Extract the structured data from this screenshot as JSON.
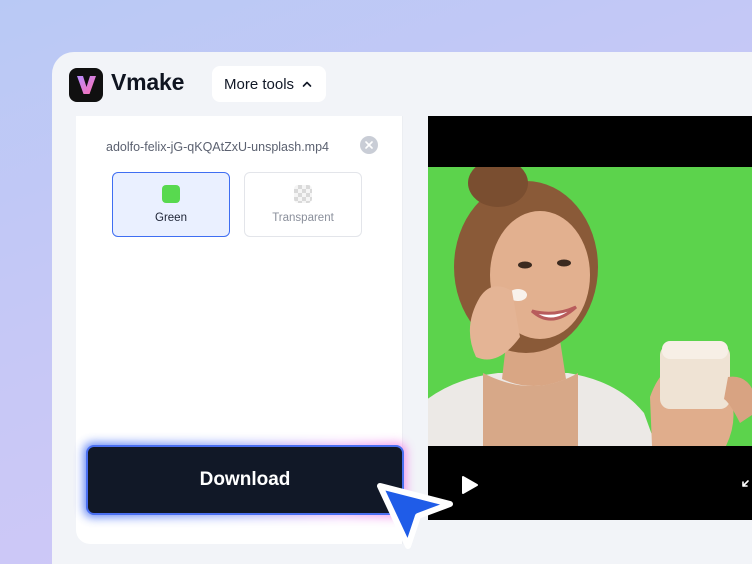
{
  "app": {
    "name": "Vmake"
  },
  "header": {
    "more_tools_label": "More tools"
  },
  "panel": {
    "filename": "adolfo-felix-jG-qKQAtZxU-unsplash.mp4",
    "background_options": [
      {
        "label": "Green",
        "selected": true
      },
      {
        "label": "Transparent",
        "selected": false
      }
    ],
    "download_label": "Download"
  },
  "colors": {
    "accent": "#3f6ef2",
    "green_screen": "#5cd34c",
    "download_bg": "#111827",
    "cursor": "#1f5ce8"
  }
}
